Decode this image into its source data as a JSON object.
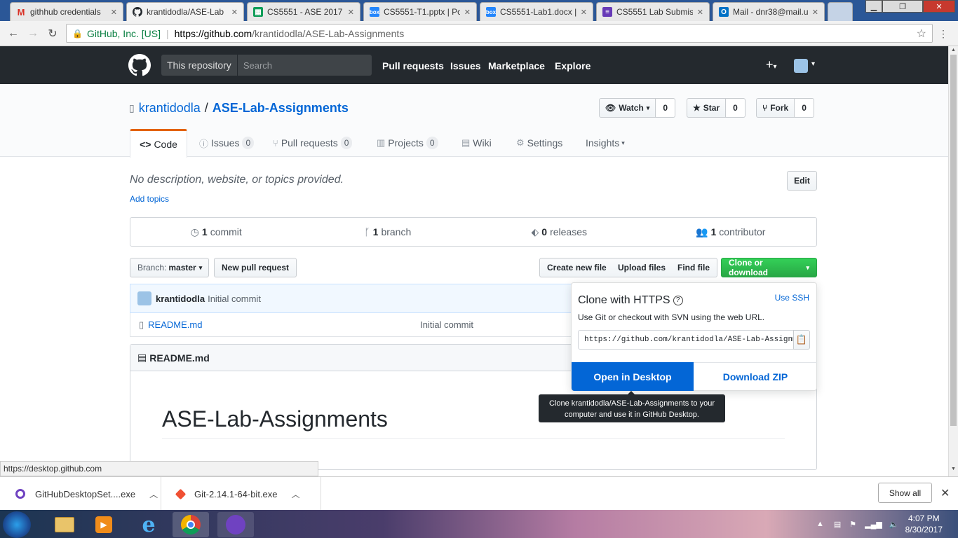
{
  "browser": {
    "tabs": [
      {
        "label": "githhub credentials",
        "icon": "gmail-icon",
        "color": "#d93025"
      },
      {
        "label": "krantidodla/ASE-Lab",
        "icon": "github-icon",
        "color": "#24292e"
      },
      {
        "label": "CS5551 - ASE 2017",
        "icon": "sheets-icon",
        "color": "#0f9d58"
      },
      {
        "label": "CS5551-T1.pptx | Po",
        "icon": "box-icon",
        "color": "#2486fc"
      },
      {
        "label": "CS5551-Lab1.docx |",
        "icon": "box-icon",
        "color": "#2486fc"
      },
      {
        "label": "CS5551 Lab Submis",
        "icon": "forms-icon",
        "color": "#673ab7"
      },
      {
        "label": "Mail - dnr38@mail.u",
        "icon": "outlook-icon",
        "color": "#0072c6"
      }
    ],
    "address": {
      "org": "GitHub, Inc. [US]",
      "host": "https://github.com",
      "path": "/krantidodla/ASE-Lab-Assignments"
    },
    "status_url": "https://desktop.github.com"
  },
  "gh_header": {
    "scope": "This repository",
    "search_placeholder": "Search",
    "nav": [
      "Pull requests",
      "Issues",
      "Marketplace",
      "Explore"
    ],
    "plus": "+",
    "plus_caret": "▾"
  },
  "repo": {
    "owner": "krantidodla",
    "name": "ASE-Lab-Assignments",
    "watch": {
      "label": "Watch",
      "count": "0"
    },
    "star": {
      "label": "Star",
      "count": "0"
    },
    "fork": {
      "label": "Fork",
      "count": "0"
    },
    "tabs": {
      "code": "Code",
      "issues": {
        "label": "Issues",
        "count": "0"
      },
      "pulls": {
        "label": "Pull requests",
        "count": "0"
      },
      "projects": {
        "label": "Projects",
        "count": "0"
      },
      "wiki": "Wiki",
      "settings": "Settings",
      "insights": "Insights"
    },
    "description": "No description, website, or topics provided.",
    "add_topics": "Add topics",
    "edit": "Edit",
    "numbers": {
      "commits": {
        "n": "1",
        "label": "commit"
      },
      "branches": {
        "n": "1",
        "label": "branch"
      },
      "releases": {
        "n": "0",
        "label": "releases"
      },
      "contributors": {
        "n": "1",
        "label": "contributor"
      }
    },
    "branch_label": "Branch:",
    "branch": "master",
    "new_pr": "New pull request",
    "create_file": "Create new file",
    "upload_files": "Upload files",
    "find_file": "Find file",
    "clone_download": "Clone or download",
    "commit": {
      "author": "krantidodla",
      "message": "Initial commit"
    },
    "files": [
      {
        "name": "README.md",
        "message": "Initial commit"
      }
    ],
    "readme": {
      "filename": "README.md",
      "heading": "ASE-Lab-Assignments"
    }
  },
  "clone": {
    "title": "Clone with HTTPS",
    "use_ssh": "Use SSH",
    "help": "Use Git or checkout with SVN using the web URL.",
    "url": "https://github.com/krantidodla/ASE-Lab-Assignments.git",
    "open_desktop": "Open in Desktop",
    "download_zip": "Download ZIP",
    "tooltip_line1": "Clone krantidodla/ASE-Lab-Assignments to your",
    "tooltip_line2": "computer and use it in GitHub Desktop."
  },
  "downloads": {
    "items": [
      {
        "name": "GitHubDesktopSet....exe",
        "color": "#6f42c1"
      },
      {
        "name": "Git-2.14.1-64-bit.exe",
        "color": "#f05033"
      }
    ],
    "show_all": "Show all"
  },
  "taskbar": {
    "time": "4:07 PM",
    "date": "8/30/2017"
  }
}
